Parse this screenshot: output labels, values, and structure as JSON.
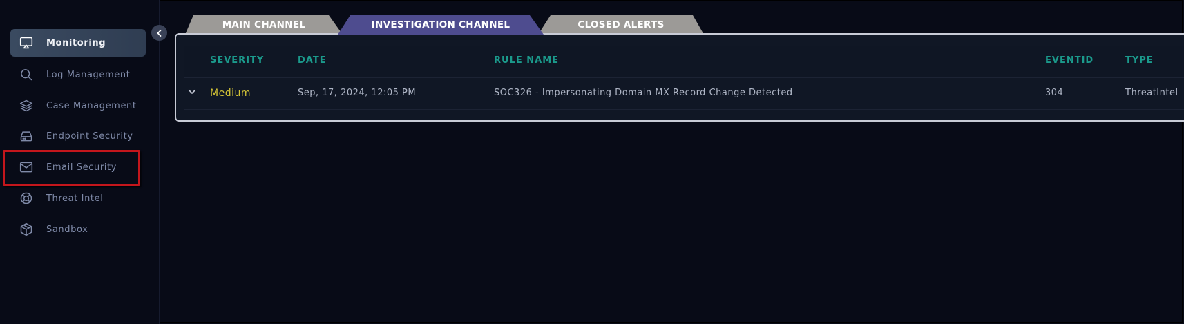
{
  "sidebar": {
    "items": [
      {
        "label": "Monitoring",
        "icon": "monitor-cast-icon",
        "active": true
      },
      {
        "label": "Log Management",
        "icon": "search-icon"
      },
      {
        "label": "Case Management",
        "icon": "layers-icon"
      },
      {
        "label": "Endpoint Security",
        "icon": "hard-drive-icon"
      },
      {
        "label": "Email Security",
        "icon": "mail-icon"
      },
      {
        "label": "Threat Intel",
        "icon": "lifebuoy-icon"
      },
      {
        "label": "Sandbox",
        "icon": "cube-icon"
      }
    ]
  },
  "tabs": [
    {
      "label": "MAIN CHANNEL"
    },
    {
      "label": "INVESTIGATION CHANNEL",
      "active": true
    },
    {
      "label": "CLOSED ALERTS"
    }
  ],
  "table": {
    "columns": [
      "SEVERITY",
      "DATE",
      "RULE NAME",
      "EVENTID",
      "TYPE"
    ],
    "rows": [
      {
        "severity": "Medium",
        "date": "Sep, 17, 2024, 12:05 PM",
        "rule_name": "SOC326 - Impersonating Domain MX Record Change Detected",
        "event_id": "304",
        "type": "ThreatIntel"
      }
    ]
  },
  "colors": {
    "background": "#080b17",
    "accent_teal": "#1b9a8c",
    "severity_medium": "#d4c436",
    "active_tab": "#4e4c8f",
    "inactive_tab": "#9c9a97",
    "highlight": "#c4161c"
  }
}
